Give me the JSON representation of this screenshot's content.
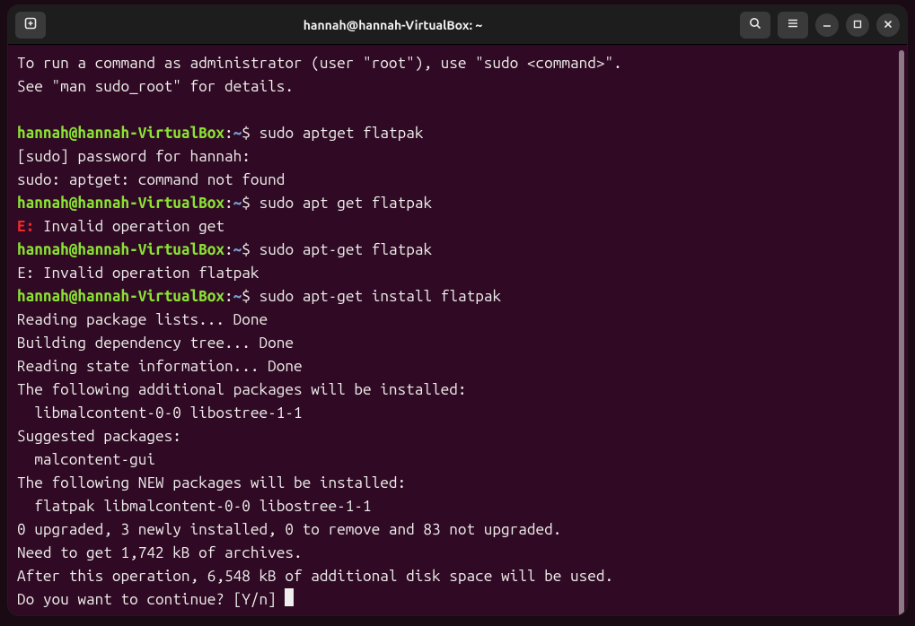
{
  "window": {
    "title": "hannah@hannah-VirtualBox: ~"
  },
  "prompt": {
    "user_host": "hannah@hannah-VirtualBox",
    "sep": ":",
    "path": "~",
    "symbol": "$"
  },
  "lines": {
    "intro1": "To run a command as administrator (user \"root\"), use \"sudo <command>\".",
    "intro2": "See \"man sudo_root\" for details.",
    "blank": "",
    "cmd1": " sudo aptget flatpak",
    "out1a": "[sudo] password for hannah: ",
    "out1b": "sudo: aptget: command not found",
    "cmd2": " sudo apt get flatpak",
    "err2_label": "E:",
    "err2_msg": " Invalid operation get",
    "cmd3": " sudo apt-get flatpak",
    "out3": "E: Invalid operation flatpak",
    "cmd4": " sudo apt-get install flatpak",
    "o4a": "Reading package lists... Done",
    "o4b": "Building dependency tree... Done",
    "o4c": "Reading state information... Done",
    "o4d": "The following additional packages will be installed:",
    "o4e": "  libmalcontent-0-0 libostree-1-1",
    "o4f": "Suggested packages:",
    "o4g": "  malcontent-gui",
    "o4h": "The following NEW packages will be installed:",
    "o4i": "  flatpak libmalcontent-0-0 libostree-1-1",
    "o4j": "0 upgraded, 3 newly installed, 0 to remove and 83 not upgraded.",
    "o4k": "Need to get 1,742 kB of archives.",
    "o4l": "After this operation, 6,548 kB of additional disk space will be used.",
    "o4m": "Do you want to continue? [Y/n] "
  },
  "icons": {
    "new_tab": "new-tab",
    "search": "search",
    "menu": "menu",
    "minimize": "minimize",
    "maximize": "maximize",
    "close": "close"
  }
}
